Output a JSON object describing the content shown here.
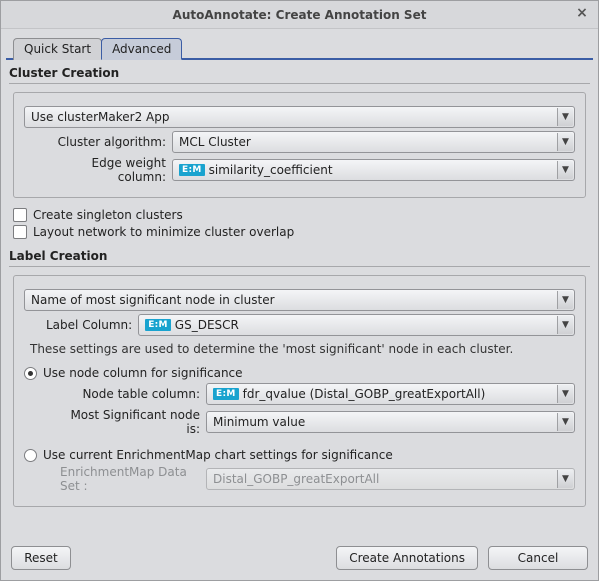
{
  "window": {
    "title": "AutoAnnotate: Create Annotation Set"
  },
  "tabs": {
    "quick_start": "Quick Start",
    "advanced": "Advanced",
    "active": "advanced"
  },
  "cluster": {
    "section_title": "Cluster Creation",
    "source": "Use clusterMaker2 App",
    "algo_label": "Cluster algorithm:",
    "algo_value": "MCL Cluster",
    "edge_label": "Edge weight column:",
    "edge_badge": "E:M",
    "edge_value": "similarity_coefficient",
    "chk_singleton": "Create singleton clusters",
    "chk_layout": "Layout network to minimize cluster overlap"
  },
  "label": {
    "section_title": "Label Creation",
    "method": "Name of most significant node in cluster",
    "col_label": "Label Column:",
    "col_badge": "E:M",
    "col_value": "GS_DESCR",
    "hint": "These settings are used to determine the 'most significant' node in each cluster.",
    "radio_node": "Use node column for significance",
    "node_col_label": "Node table column:",
    "node_col_badge": "E:M",
    "node_col_value": "fdr_qvalue (Distal_GOBP_greatExportAll)",
    "most_sig_label": "Most Significant node is:",
    "most_sig_value": "Minimum value",
    "radio_chart": "Use current EnrichmentMap chart settings for significance",
    "em_set_label": "EnrichmentMap Data Set :",
    "em_set_value": "Distal_GOBP_greatExportAll"
  },
  "buttons": {
    "reset": "Reset",
    "create": "Create Annotations",
    "cancel": "Cancel"
  }
}
